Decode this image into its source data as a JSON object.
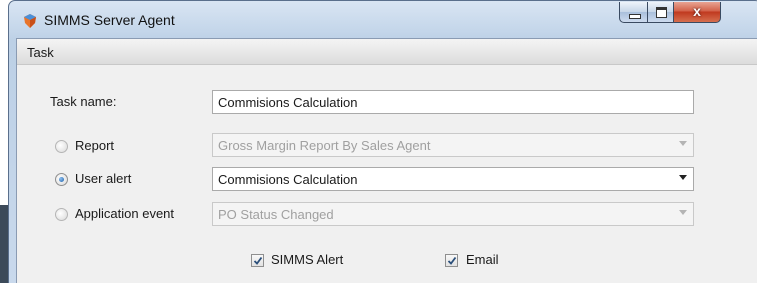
{
  "window": {
    "title": "SIMMS Server Agent",
    "close_glyph": "x"
  },
  "icons": {
    "app": "shield-icon",
    "minimize": "minimize-icon",
    "maximize": "maximize-icon",
    "close": "close-icon"
  },
  "group": {
    "title": "Task"
  },
  "form": {
    "task_name_label": "Task name:",
    "task_name_value": "Commisions Calculation",
    "report": {
      "label": "Report",
      "selected": false,
      "value": "Gross Margin Report By Sales Agent",
      "enabled": false
    },
    "user_alert": {
      "label": "User alert",
      "selected": true,
      "value": "Commisions Calculation",
      "enabled": true
    },
    "application_event": {
      "label": "Application event",
      "selected": false,
      "value": "PO Status Changed",
      "enabled": false
    },
    "simms_alert": {
      "label": "SIMMS Alert",
      "checked": true
    },
    "email": {
      "label": "Email",
      "checked": true
    }
  },
  "colors": {
    "title_bar": "#c4d6ea",
    "close_button": "#c0391f",
    "panel": "#f0f0f0"
  }
}
